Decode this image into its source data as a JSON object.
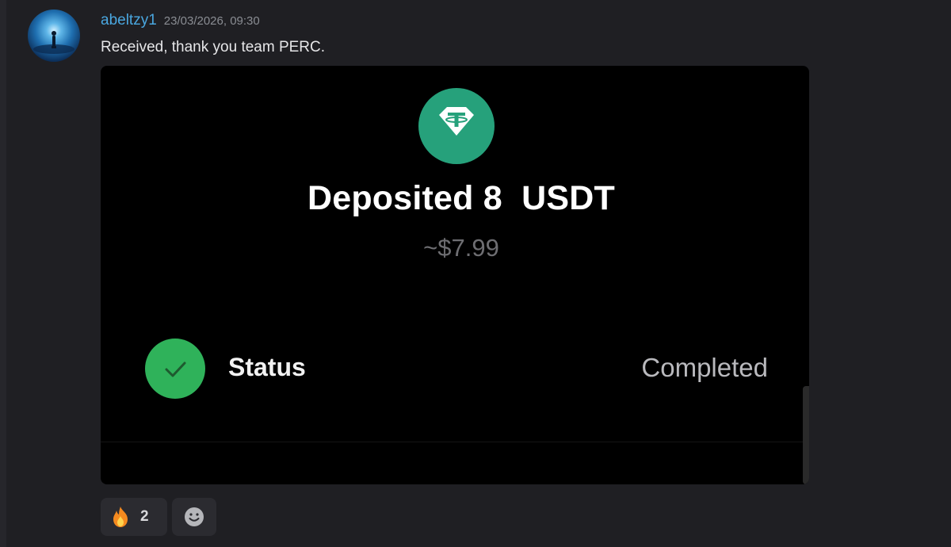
{
  "message": {
    "username": "abeltzy1",
    "timestamp": "23/03/2026, 09:30",
    "text": "Received, thank you team PERC."
  },
  "attachment": {
    "token_icon": "tether-usdt-icon",
    "amount_text": "Deposited 8  USDT",
    "fiat_text": "~$7.99",
    "status_label": "Status",
    "status_value": "Completed",
    "status_icon": "check-circle-icon",
    "colors": {
      "tether": "#26a17b",
      "success": "#2fb25a"
    }
  },
  "reactions": [
    {
      "emoji": "fire-icon",
      "count": "2"
    },
    {
      "emoji": "add-reaction-icon"
    }
  ],
  "colors": {
    "username": "#4aa7e0",
    "background": "#1f1f23"
  }
}
